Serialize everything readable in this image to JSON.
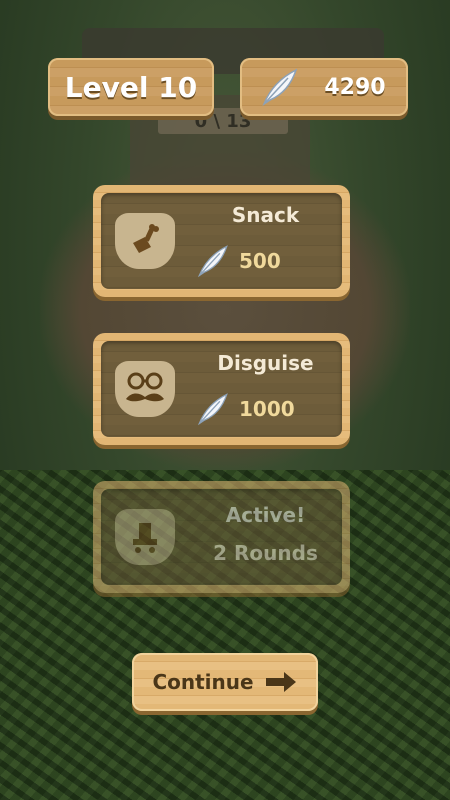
{
  "header": {
    "level_label": "Level 10",
    "feathers": "4290"
  },
  "background": {
    "coop_counter": "0 \\ 13"
  },
  "shop": {
    "items": [
      {
        "title": "Snack",
        "cost": "500",
        "icon": "meat-drumstick-icon"
      },
      {
        "title": "Disguise",
        "cost": "1000",
        "icon": "glasses-mustache-icon"
      },
      {
        "title": "Active!",
        "status": "2 Rounds",
        "icon": "skate-icon"
      }
    ]
  },
  "footer": {
    "continue_label": "Continue"
  },
  "colors": {
    "wood": "#c79a5c",
    "card_inner": "#6d5c3a",
    "cost_text": "#f0d99c"
  }
}
